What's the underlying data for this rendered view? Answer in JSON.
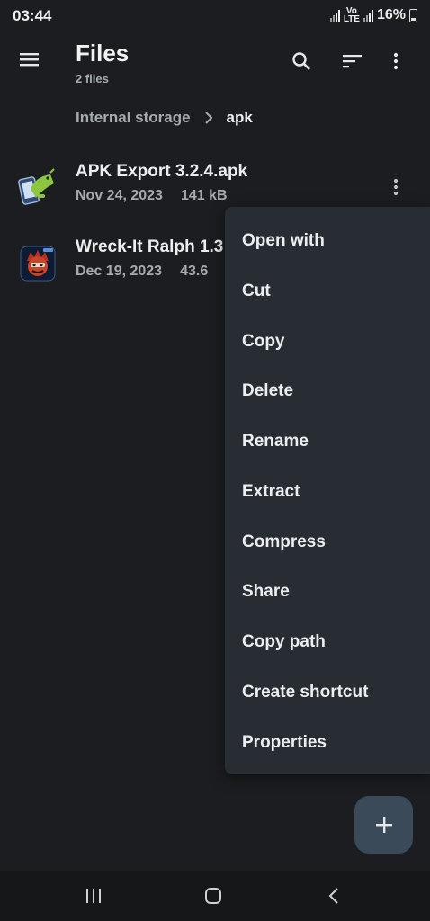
{
  "status_bar": {
    "time": "03:44",
    "volte_top": "Vo",
    "volte_bottom": "LTE",
    "battery": "16%"
  },
  "app_bar": {
    "title": "Files",
    "subtitle": "2 files",
    "icons": [
      "menu-icon",
      "search-icon",
      "sort-icon",
      "more-vert-icon"
    ]
  },
  "breadcrumb": {
    "root": "Internal storage",
    "current": "apk"
  },
  "files": [
    {
      "name": "APK Export 3.2.4.apk",
      "date": "Nov 24, 2023",
      "size": "141 kB",
      "icon": "android-apk-icon"
    },
    {
      "name": "Wreck-It Ralph 1.3",
      "date": "Dec 19, 2023",
      "size": "43.6",
      "icon": "wreck-it-ralph-app-icon"
    }
  ],
  "context_menu": {
    "items": [
      "Open with",
      "Cut",
      "Copy",
      "Delete",
      "Rename",
      "Extract",
      "Compress",
      "Share",
      "Copy path",
      "Create shortcut",
      "Properties"
    ]
  },
  "fab": {
    "icon": "plus-icon"
  },
  "nav_bar": {
    "icons": [
      "recent-apps-icon",
      "home-icon",
      "back-icon"
    ]
  },
  "colors": {
    "background": "#1b1d20",
    "menu_background": "#272d33",
    "fab_background": "#3b4a58",
    "primary_text": "#eceef0",
    "secondary_text": "#a7abb0"
  }
}
